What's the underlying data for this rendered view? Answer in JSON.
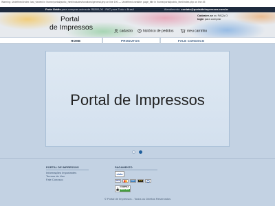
{
  "error_bar": {
    "text": "Warning: Undefined index: last_viewed in /home/portal/public_html/includes/functions/general.php on line 190 — Undefined variable: page_title in /home/portal/public_html/index.php on line 45"
  },
  "top_bar": {
    "shipping_label": "Frete Grátis",
    "shipping_text": "para compras acima de R$500,00 - PAC para Todo o Brasil",
    "service_label": "Atendimento:",
    "service_email": "contato@portaldeimpressos.com.br"
  },
  "logo": {
    "line1": "Portal",
    "line2": "de Impressos"
  },
  "account_info": {
    "line1_bold": "Cadastre-se",
    "line1_rest": "ou FAÇA O",
    "line2_bold": "login",
    "line2_rest": "para comprar"
  },
  "header_links": {
    "register": "cadastro",
    "order_history": "histórico de pedidos",
    "cart": "meu carrinho"
  },
  "nav": {
    "home": "HOME",
    "products": "PRODUTOS",
    "contact": "FALE CONOSCO"
  },
  "slide": {
    "title": "Portal de Impressos"
  },
  "footer": {
    "col1_title": "PORTAL DE IMPRESSOS",
    "col1_links": [
      "Informações Importantes",
      "Termos de Uso",
      "Fale Conosco"
    ],
    "col2_title": "PAGAMENTO",
    "cielo": "cielo",
    "cards": [
      "VISA",
      "MC",
      "AMEX",
      "ELO",
      "DINERS"
    ],
    "secure_line1": "COMPRA",
    "secure_line2": "SEGURA",
    "copyright": "© Portal de Impressos - Todos os Direitos Reservados"
  },
  "colors": {
    "top_bar": "#1e2b3e",
    "nav_link": "#3a5a80",
    "page_bg": "#c3d2e3",
    "slide_bg": "#d9e5f1",
    "active_dot": "#1f5f9c"
  }
}
